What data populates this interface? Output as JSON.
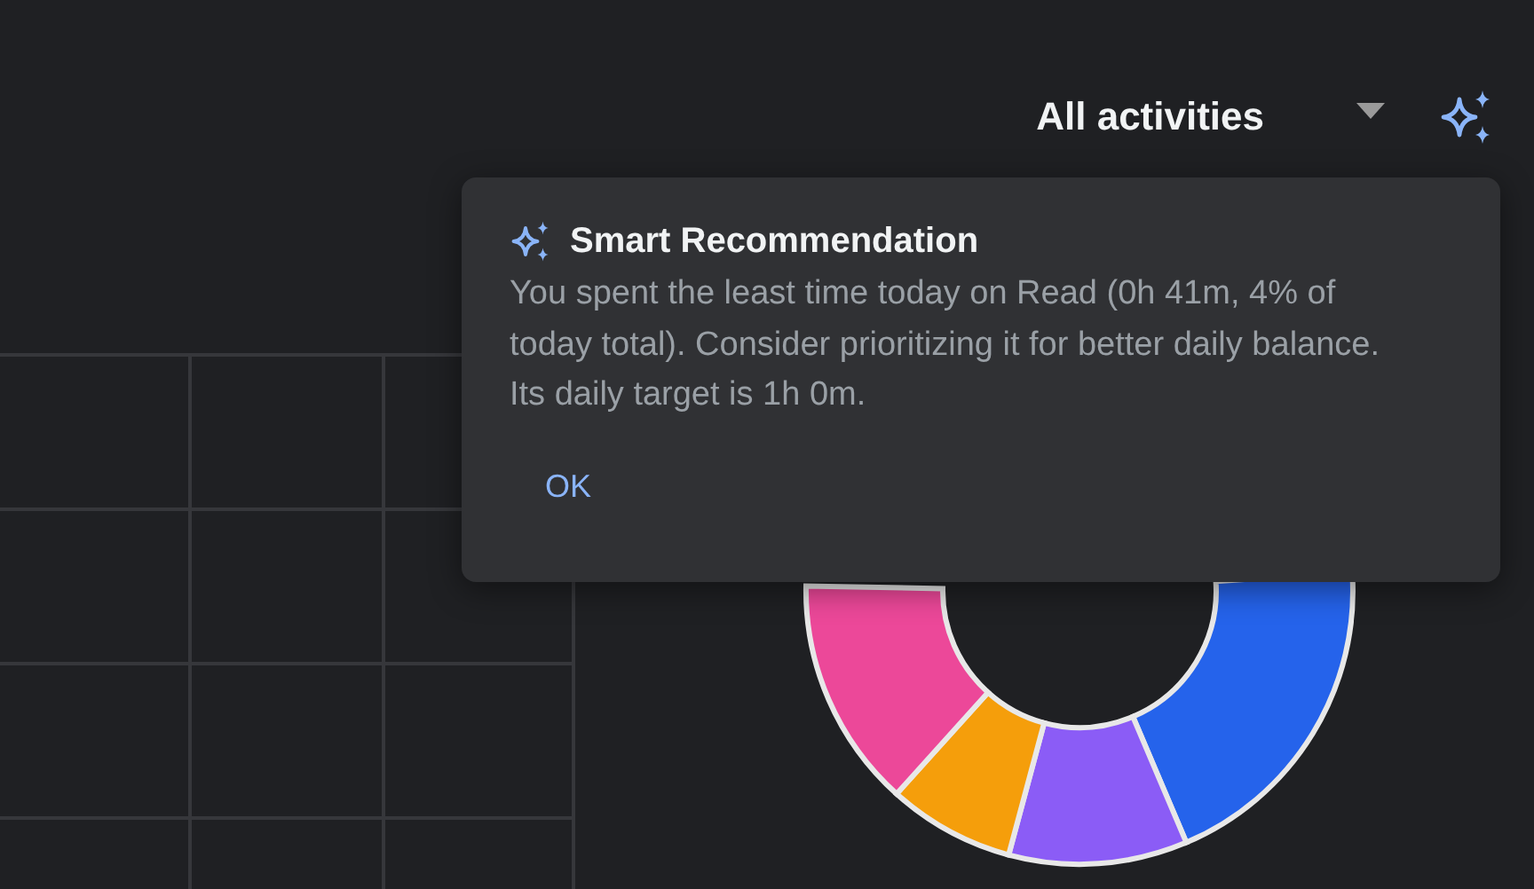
{
  "header": {
    "activity_filter": "All activities"
  },
  "dialog": {
    "title": "Smart Recommendation",
    "message": "You spent the least time today on Read (0h 41m, 4% of today total). Consider prioritizing it for better daily balance. Its daily target is 1h 0m.",
    "button": "OK"
  }
}
